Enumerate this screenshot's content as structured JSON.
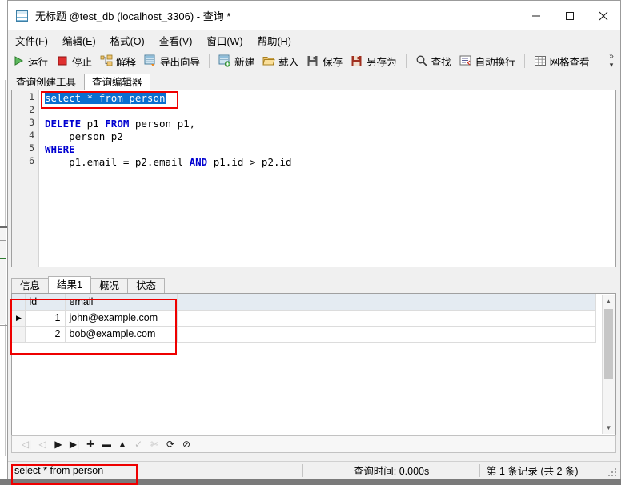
{
  "window": {
    "title": "无标题 @test_db (localhost_3306) - 查询 *",
    "icon": "database-table-icon",
    "controls": [
      {
        "name": "minimize-button",
        "glyph": "minimize-icon"
      },
      {
        "name": "maximize-button",
        "glyph": "maximize-icon"
      },
      {
        "name": "close-button",
        "glyph": "close-icon"
      }
    ]
  },
  "menubar": {
    "items": [
      {
        "label": "文件(F)",
        "name": "menu-file"
      },
      {
        "label": "编辑(E)",
        "name": "menu-edit"
      },
      {
        "label": "格式(O)",
        "name": "menu-format"
      },
      {
        "label": "查看(V)",
        "name": "menu-view"
      },
      {
        "label": "窗口(W)",
        "name": "menu-window"
      },
      {
        "label": "帮助(H)",
        "name": "menu-help"
      }
    ]
  },
  "toolbar": {
    "run_label": "运行",
    "stop_label": "停止",
    "explain_label": "解释",
    "export_wizard_label": "导出向导",
    "new_label": "新建",
    "load_label": "载入",
    "save_label": "保存",
    "save_as_label": "另存为",
    "find_label": "查找",
    "wrap_label": "自动换行",
    "grid_view_label": "网格查看",
    "overflow_chevron": "»",
    "overflow_caret": "▾"
  },
  "tabs": {
    "items": [
      {
        "label": "查询创建工具",
        "name": "tab-query-builder",
        "active": false
      },
      {
        "label": "查询编辑器",
        "name": "tab-query-editor",
        "active": true
      }
    ]
  },
  "editor": {
    "line_numbers": [
      "1",
      "2",
      "3",
      "4",
      "5",
      "6"
    ],
    "lines": [
      {
        "selected": true,
        "tokens": [
          {
            "t": "select * from person",
            "kw": false
          }
        ]
      },
      {
        "selected": false,
        "tokens": []
      },
      {
        "selected": false,
        "tokens": [
          {
            "t": "DELETE",
            "kw": true
          },
          {
            "t": " p1 ",
            "kw": false
          },
          {
            "t": "FROM",
            "kw": true
          },
          {
            "t": " person p1,",
            "kw": false
          }
        ]
      },
      {
        "selected": false,
        "tokens": [
          {
            "t": "    person p2",
            "kw": false
          }
        ]
      },
      {
        "selected": false,
        "tokens": [
          {
            "t": "WHERE",
            "kw": true
          }
        ]
      },
      {
        "selected": false,
        "tokens": [
          {
            "t": "    p1.email = p2.email ",
            "kw": false
          },
          {
            "t": "AND",
            "kw": true
          },
          {
            "t": " p1.id > p2.id",
            "kw": false
          }
        ]
      }
    ],
    "selection_color": "#0a6fd0",
    "keyword_color": "#0000d0"
  },
  "results": {
    "tabs": [
      {
        "label": "信息",
        "name": "result-tab-message",
        "active": false
      },
      {
        "label": "结果1",
        "name": "result-tab-result1",
        "active": true
      },
      {
        "label": "概况",
        "name": "result-tab-profile",
        "active": false
      },
      {
        "label": "状态",
        "name": "result-tab-status",
        "active": false
      }
    ],
    "columns": [
      "id",
      "email"
    ],
    "rows": [
      {
        "marker": "▶",
        "id": "1",
        "email": "john@example.com"
      },
      {
        "marker": "",
        "id": "2",
        "email": "bob@example.com"
      }
    ]
  },
  "navbar": {
    "buttons": [
      {
        "name": "first-record-button",
        "glyph": "◁|",
        "disabled": true
      },
      {
        "name": "previous-record-button",
        "glyph": "◁",
        "disabled": true
      },
      {
        "name": "next-record-button",
        "glyph": "▶",
        "disabled": false
      },
      {
        "name": "last-record-button",
        "glyph": "▶|",
        "disabled": false
      },
      {
        "name": "add-record-button",
        "glyph": "✚",
        "disabled": false
      },
      {
        "name": "delete-record-button",
        "glyph": "▬",
        "disabled": false
      },
      {
        "name": "apply-record-button",
        "glyph": "▲",
        "disabled": false
      },
      {
        "name": "confirm-record-button",
        "glyph": "✓",
        "disabled": true
      },
      {
        "name": "cancel-edit-button",
        "glyph": "✄",
        "disabled": true
      },
      {
        "name": "refresh-button",
        "glyph": "⟳",
        "disabled": false
      },
      {
        "name": "stop-button",
        "glyph": "⊘",
        "disabled": false
      }
    ]
  },
  "statusbar": {
    "query_text": "select * from person",
    "query_time": "查询时间: 0.000s",
    "record_info": "第 1 条记录 (共 2 条)"
  },
  "annotations": {
    "accent_color": "#ee0000",
    "boxes": [
      "sql-statement-highlight",
      "result-grid-highlight",
      "status-query-highlight"
    ]
  }
}
